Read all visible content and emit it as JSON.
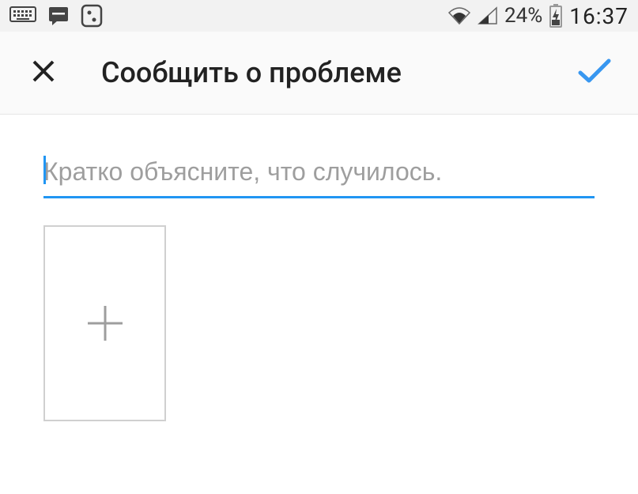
{
  "status_bar": {
    "battery_pct": "24%",
    "time": "16:37"
  },
  "app_bar": {
    "title": "Сообщить о проблеме"
  },
  "form": {
    "input_value": "",
    "input_placeholder": "Кратко объясните, что случилось."
  }
}
